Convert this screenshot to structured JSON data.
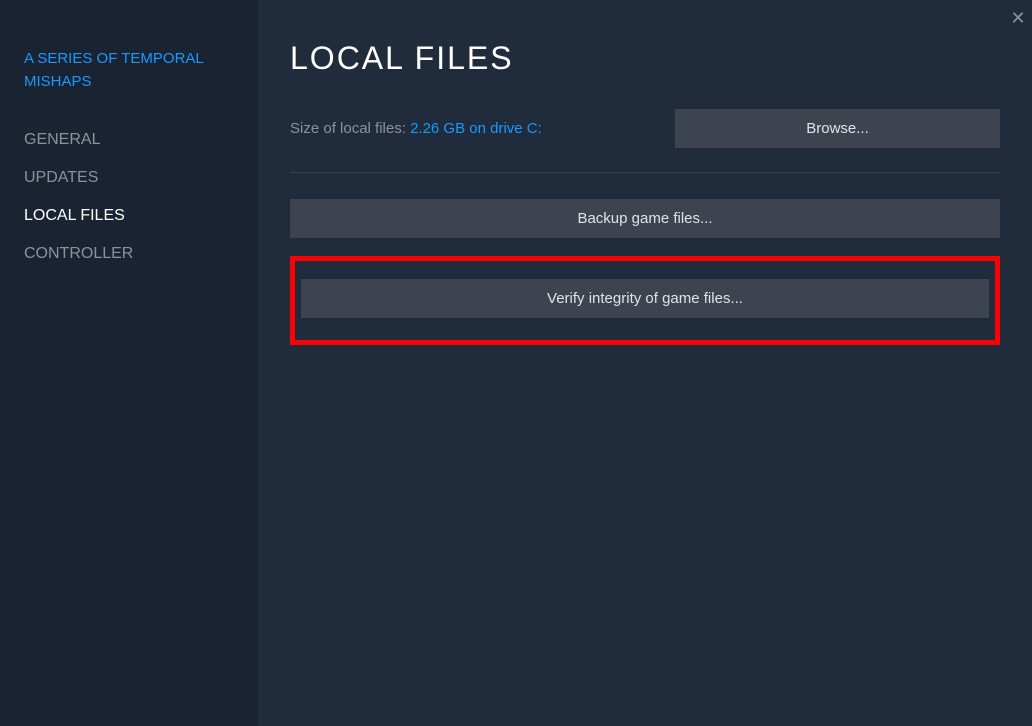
{
  "sidebar": {
    "gameTitle": "A SERIES OF TEMPORAL MISHAPS",
    "items": [
      {
        "label": "GENERAL",
        "active": false
      },
      {
        "label": "UPDATES",
        "active": false
      },
      {
        "label": "LOCAL FILES",
        "active": true
      },
      {
        "label": "CONTROLLER",
        "active": false
      }
    ]
  },
  "main": {
    "title": "LOCAL FILES",
    "sizeLabel": "Size of local files: ",
    "sizeValue": "2.26 GB on drive C:",
    "browseLabel": "Browse...",
    "backupLabel": "Backup game files...",
    "verifyLabel": "Verify integrity of game files..."
  },
  "closeIcon": "✕"
}
